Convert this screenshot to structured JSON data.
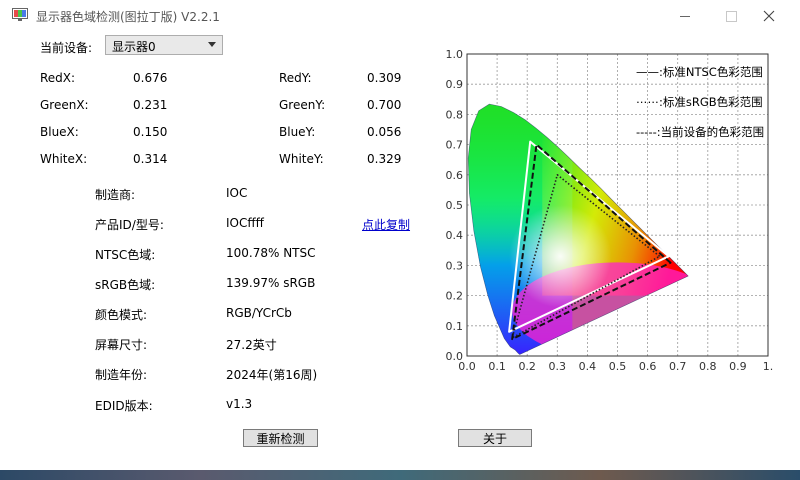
{
  "window": {
    "title": "显示器色域检测(图拉丁版) V2.2.1"
  },
  "device": {
    "label": "当前设备:",
    "selected": "显示器0"
  },
  "chromaticity": [
    {
      "label": "RedX:",
      "value": "0.676"
    },
    {
      "label": "RedY:",
      "value": "0.309"
    },
    {
      "label": "GreenX:",
      "value": "0.231"
    },
    {
      "label": "GreenY:",
      "value": "0.700"
    },
    {
      "label": "BlueX:",
      "value": "0.150"
    },
    {
      "label": "BlueY:",
      "value": "0.056"
    },
    {
      "label": "WhiteX:",
      "value": "0.314"
    },
    {
      "label": "WhiteY:",
      "value": "0.329"
    }
  ],
  "info": [
    {
      "label": "制造商:",
      "value": "IOC"
    },
    {
      "label": "产品ID/型号:",
      "value": "IOCffff"
    },
    {
      "label": "NTSC色域:",
      "value": "100.78% NTSC"
    },
    {
      "label": "sRGB色域:",
      "value": "139.97% sRGB"
    },
    {
      "label": "颜色模式:",
      "value": "RGB/YCrCb"
    },
    {
      "label": "屏幕尺寸:",
      "value": "27.2英寸"
    },
    {
      "label": "制造年份:",
      "value": "2024年(第16周)"
    },
    {
      "label": "EDID版本:",
      "value": "v1.3"
    }
  ],
  "copy_link": "点此复制",
  "buttons": {
    "redetect": "重新检测",
    "about": "关于"
  },
  "chart_data": {
    "type": "scatter",
    "xlim": [
      0.0,
      1.0
    ],
    "ylim": [
      0.0,
      1.0
    ],
    "x_ticks": [
      "0.0",
      "0.1",
      "0.2",
      "0.3",
      "0.4",
      "0.5",
      "0.6",
      "0.7",
      "0.8",
      "0.9",
      "1."
    ],
    "y_ticks": [
      "0.0",
      "0.1",
      "0.2",
      "0.3",
      "0.4",
      "0.5",
      "0.6",
      "0.7",
      "0.8",
      "0.9",
      "1.0"
    ],
    "grid": true,
    "legend_position": "top-right",
    "legend": [
      {
        "name": "——:标准NTSC色彩范围",
        "style": "solid",
        "color": "#000000"
      },
      {
        "name": "⋯⋯:标准sRGB色彩范围",
        "style": "dotted",
        "color": "#000000"
      },
      {
        "name": "-----:当前设备的色彩范围",
        "style": "dashed",
        "color": "#000000"
      }
    ],
    "series": [
      {
        "name": "标准NTSC色彩范围",
        "points": [
          [
            0.67,
            0.33
          ],
          [
            0.21,
            0.71
          ],
          [
            0.14,
            0.08
          ]
        ]
      },
      {
        "name": "标准sRGB色彩范围",
        "points": [
          [
            0.64,
            0.33
          ],
          [
            0.3,
            0.6
          ],
          [
            0.15,
            0.06
          ]
        ]
      },
      {
        "name": "当前设备的色彩范围",
        "points": [
          [
            0.676,
            0.309
          ],
          [
            0.231,
            0.7
          ],
          [
            0.15,
            0.056
          ]
        ]
      }
    ]
  }
}
